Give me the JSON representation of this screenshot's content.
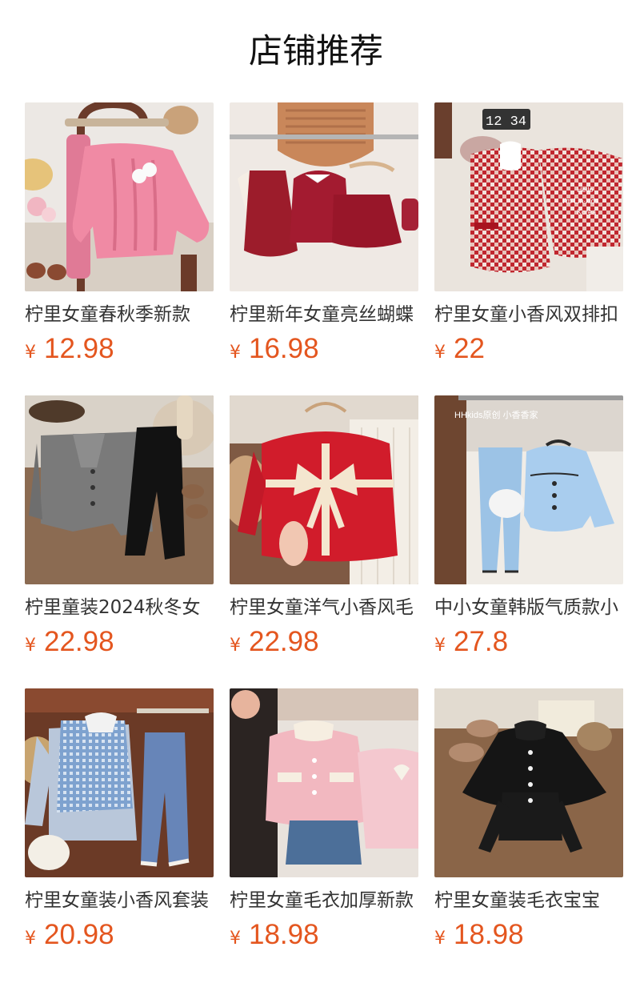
{
  "section": {
    "title": "店铺推荐"
  },
  "currency": "¥",
  "products": [
    {
      "name": "柠里女童春秋季新款",
      "price": "12.98"
    },
    {
      "name": "柠里新年女童亮丝蝴蝶",
      "price": "16.98"
    },
    {
      "name": "柠里女童小香风双排扣",
      "price": "22"
    },
    {
      "name": "柠里童装2024秋冬女",
      "price": "22.98"
    },
    {
      "name": "柠里女童洋气小香风毛",
      "price": "22.98"
    },
    {
      "name": "中小女童韩版气质款小",
      "price": "27.8"
    },
    {
      "name": "柠里女童装小香风套装",
      "price": "20.98"
    },
    {
      "name": "柠里女童毛衣加厚新款",
      "price": "18.98"
    },
    {
      "name": "柠里女童装毛衣宝宝",
      "price": "18.98"
    }
  ],
  "photo_texts": {
    "clock": "12 34",
    "sticker_1": "Hello",
    "sticker_2": "I'm Lin·kids",
    "sticker_3": "Korea",
    "shop_tag": "HHkids原创 小香香家"
  }
}
